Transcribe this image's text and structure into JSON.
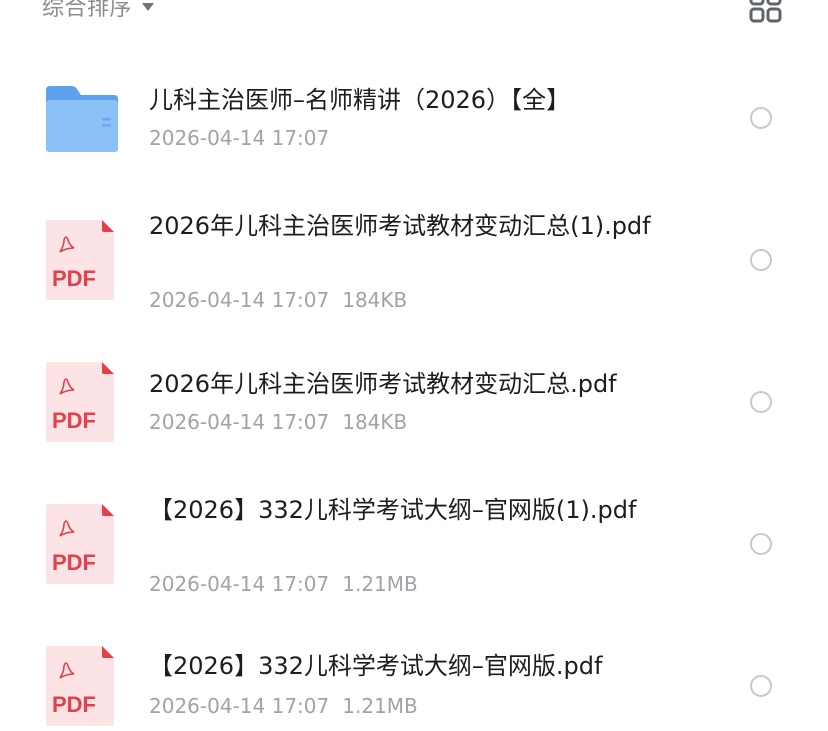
{
  "toolbar": {
    "sort_label": "综合排序",
    "sort_icon": "caret-down-icon",
    "view_icon": "grid-view-icon"
  },
  "colors": {
    "folder": "#7fb8f5",
    "pdf_red": "#e0414b",
    "pdf_page": "#fbe3e6",
    "meta_text": "#a0a3aa",
    "name_text": "#1c1d20"
  },
  "files": [
    {
      "type": "folder",
      "icon": "folder-icon",
      "name": "儿科主治医师–名师精讲（2026）【全】",
      "date": "2026-04-14 17:07",
      "size": ""
    },
    {
      "type": "pdf",
      "icon": "pdf-file-icon",
      "icon_text": "PDF",
      "name": "2026年儿科主治医师考试教材变动汇总(1).pdf",
      "date": "2026-04-14 17:07",
      "size": "184KB"
    },
    {
      "type": "pdf",
      "icon": "pdf-file-icon",
      "icon_text": "PDF",
      "name": "2026年儿科主治医师考试教材变动汇总.pdf",
      "date": "2026-04-14 17:07",
      "size": "184KB"
    },
    {
      "type": "pdf",
      "icon": "pdf-file-icon",
      "icon_text": "PDF",
      "name": "【2026】332儿科学考试大纲–官网版(1).pdf",
      "date": "2026-04-14 17:07",
      "size": "1.21MB"
    },
    {
      "type": "pdf",
      "icon": "pdf-file-icon",
      "icon_text": "PDF",
      "name": "【2026】332儿科学考试大纲–官网版.pdf",
      "date": "2026-04-14 17:07",
      "size": "1.21MB"
    }
  ]
}
